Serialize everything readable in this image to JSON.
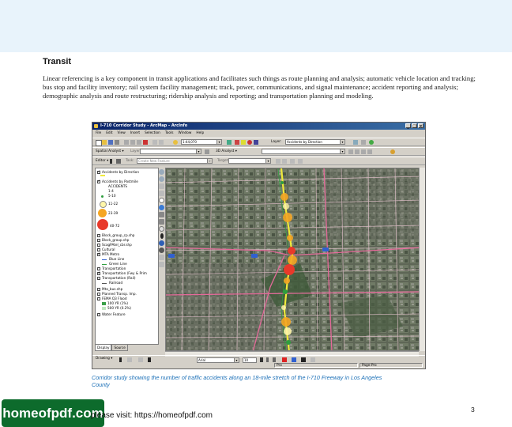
{
  "page": {
    "heading": "Transit",
    "paragraph": "Linear referencing is a key component in transit applications and facilitates such things as route planning and analysis; automatic vehicle location and tracking; bus stop and facility inventory; rail system facility management; track, power, communications, and signal maintenance; accident reporting and analysis; demographic analysis and route restructuring; ridership analysis and reporting; and transportation planning and modeling.",
    "caption": "Corridor study showing the number of traffic accidents along an 18-mile stretch of the I-710 Freeway in Los Angeles County",
    "page_number": "3",
    "promo_text": "please visit: https://homeofpdf.com",
    "logo_text": "homeofpdf.com"
  },
  "app": {
    "title": "I-710 Corridor Study - ArcMap - ArcInfo",
    "menus": [
      "File",
      "Edit",
      "View",
      "Insert",
      "Selection",
      "Tools",
      "Window",
      "Help"
    ],
    "scale": "1:44,070",
    "layer_label": "Layer:",
    "layer_value": "Accidents by Direction",
    "spatial_analyst": "Spatial Analyst ▾",
    "layer_small": "Layer:",
    "analyst_3d": "3D Analyst ▾",
    "editor": "Editor ▾",
    "task_label": "Task:",
    "task_value": "Create New Feature",
    "target_label": "Target:",
    "draw_label": "Drawing ▾",
    "font_value": "Arial",
    "font_size": "10",
    "tabs": [
      "Display",
      "Source"
    ],
    "status_left": "Pro",
    "status_right": "Page:Pro"
  },
  "toc": [
    {
      "label": "Accidents by Direction",
      "checked": true
    },
    {
      "label": "Accidents by Postmile",
      "checked": true
    },
    {
      "label": "ACCIDENTS",
      "checked": null
    },
    {
      "label": "1-4",
      "checked": null
    },
    {
      "label": "5-10",
      "checked": null
    },
    {
      "label": "11-22",
      "checked": null
    },
    {
      "label": "23-39",
      "checked": null
    },
    {
      "label": "40-72",
      "checked": null
    },
    {
      "label": "Block_group_cp.shp",
      "checked": false
    },
    {
      "label": "Block_group.shp",
      "checked": false
    },
    {
      "label": "ScagPAtel_cbr.shp",
      "checked": false
    },
    {
      "label": "Cultural",
      "checked": false
    },
    {
      "label": "MTA Metro",
      "checked": true
    },
    {
      "label": "Blue Line",
      "checked": null
    },
    {
      "label": "Green Line",
      "checked": null
    },
    {
      "label": "Transportation",
      "checked": false
    },
    {
      "label": "Transportation (Fwy & Prim",
      "checked": true
    },
    {
      "label": "Transportation (Rail)",
      "checked": false
    },
    {
      "label": "Railroad",
      "checked": null
    },
    {
      "label": "Mta_bus.shp",
      "checked": false
    },
    {
      "label": "Planned Transp. Imp.",
      "checked": false
    },
    {
      "label": "FEMA Q3 Flood",
      "checked": false
    },
    {
      "label": "100 YR (1%)",
      "checked": null
    },
    {
      "label": "500 YR (0.2%)",
      "checked": null
    },
    {
      "label": "Water Feature",
      "checked": false
    }
  ],
  "colors": {
    "caption": "#1a6fb7",
    "legend_small": "#2e9e3e",
    "legend_mid1": "#fff6a8",
    "legend_mid2": "#f5a623",
    "legend_large": "#e8392a",
    "freeway": "#f0ea3a"
  }
}
